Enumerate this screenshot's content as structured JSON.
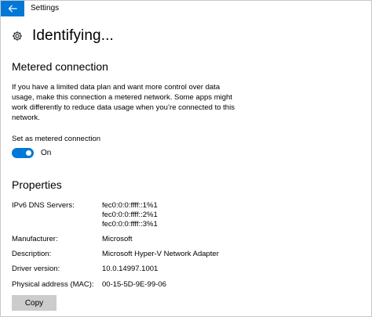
{
  "window": {
    "title": "Settings"
  },
  "page": {
    "title": "Identifying..."
  },
  "metered": {
    "heading": "Metered connection",
    "description": "If you have a limited data plan and want more control over data usage, make this connection a metered network. Some apps might work differently to reduce data usage when you’re connected to this network.",
    "toggle_label": "Set as metered connection",
    "toggle_state": "On",
    "toggle_on": true
  },
  "properties": {
    "heading": "Properties",
    "ipv6_label": "IPv6 DNS Servers:",
    "ipv6_values": [
      "fec0:0:0:ffff::1%1",
      "fec0:0:0:ffff::2%1",
      "fec0:0:0:ffff::3%1"
    ],
    "manufacturer_label": "Manufacturer:",
    "manufacturer_value": "Microsoft",
    "description_label": "Description:",
    "description_value": "Microsoft Hyper-V Network Adapter",
    "driver_label": "Driver version:",
    "driver_value": "10.0.14997.1001",
    "mac_label": "Physical address (MAC):",
    "mac_value": "00-15-5D-9E-99-06",
    "copy_label": "Copy"
  },
  "colors": {
    "accent": "#0078d7",
    "button_bg": "#cccccc"
  },
  "icons": {
    "back": "back-arrow-icon",
    "settings": "gear-icon"
  }
}
